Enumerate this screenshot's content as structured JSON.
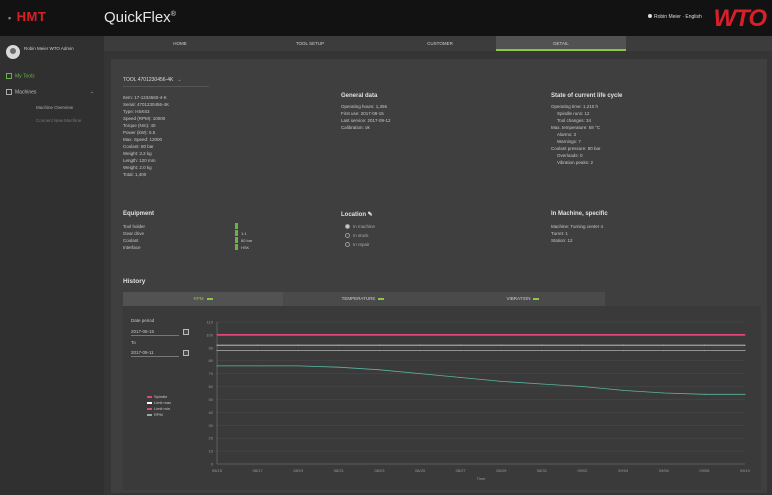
{
  "topbar": {
    "left_logo": "HMT",
    "app_title": "QuickFlex",
    "app_title_mark": "®",
    "user_menu": "Robin Meier · English",
    "brand_logo": "WTO"
  },
  "sidebar": {
    "profile_name": "Robin Meier WTO Admin",
    "items": [
      {
        "label": "My Tools",
        "icon": "wrench-icon"
      },
      {
        "label": "Machines",
        "icon": "machine-icon"
      }
    ],
    "sub_items": [
      "Machine Overview",
      "Connect New Machine"
    ]
  },
  "tabs": [
    "HOME",
    "TOOL SETUP",
    "CUSTOMER",
    "DETAIL"
  ],
  "active_tab": "DETAIL",
  "tool": {
    "header": "TOOL 4701230456-4K",
    "left_fields": [
      "Item: 17-1234560-4-K",
      "Serial: 4701230456-4K",
      "Type: HSK63",
      "Speed (RPM): 10000",
      "Torque (Nm): 40",
      "Power (kW): 5.5",
      "Max. Speed: 12000",
      "Coolant: 80 bar",
      "Weight: 3.2 kg",
      "Length: 120 mm",
      "Weight: 2.0 kg",
      "Total: 1,400"
    ],
    "general_title": "General data",
    "general_fields": [
      "Operating hours: 1,356",
      "First use: 2017-08-15",
      "Last service: 2017-09-12",
      "Calibration: ok"
    ],
    "state_title": "State of current life cycle",
    "state_fields": [
      "Operating time: 1,210 h",
      "Spindle runs: 12",
      "Tool changes: 34",
      "Max. temperature: 58 °C",
      "Alarms: 3",
      "Warnings: 7",
      "Coolant pressure: 80 bar",
      "Overloads: 0",
      "Vibration peaks: 2"
    ]
  },
  "equipment": {
    "title": "Equipment",
    "rows": [
      {
        "label": "Tool holder",
        "value": ""
      },
      {
        "label": "Gear drive",
        "value": "1:1"
      },
      {
        "label": "Coolant",
        "value": "80 bar"
      },
      {
        "label": "Interface",
        "value": "HSK"
      }
    ]
  },
  "location": {
    "title": "Location",
    "options": [
      "In machine",
      "In stock",
      "In repair"
    ],
    "selected": 0
  },
  "machine_specific": {
    "title": "In Machine, specific",
    "fields": [
      "Machine: Turning center 4",
      "Turret: 1",
      "Station: 12"
    ]
  },
  "history": {
    "title": "History",
    "subtabs": [
      "RPM",
      "TEMPERATURE",
      "VIBRATION"
    ],
    "active_subtab": 0,
    "date_label": "Date period",
    "from_date": "2017-08-15",
    "to_label": "To",
    "to_date": "2017-09-11",
    "legend": [
      {
        "name": "Spindle",
        "color": "#e0457b"
      },
      {
        "name": "Limit max",
        "color": "#ffffff"
      },
      {
        "name": "Limit min",
        "color": "#e0457b"
      },
      {
        "name": "RPM",
        "color": "#9aa3a8"
      }
    ],
    "x_axis_label": "Time"
  },
  "chart_data": {
    "type": "line",
    "x_ticks": [
      "08/15",
      "08/17",
      "08/19",
      "08/21",
      "08/23",
      "08/25",
      "08/27",
      "08/29",
      "08/31",
      "09/02",
      "09/04",
      "09/06",
      "09/08",
      "09/10"
    ],
    "series": [
      {
        "name": "Spindle",
        "color": "#e0457b",
        "values": [
          100,
          100,
          100,
          100,
          100,
          100,
          100,
          100,
          100,
          100,
          100,
          100,
          100,
          100
        ]
      },
      {
        "name": "Limit max",
        "color": "#d0d0d0",
        "values": [
          92,
          92,
          92,
          92,
          92,
          92,
          92,
          92,
          92,
          92,
          92,
          92,
          92,
          92
        ]
      },
      {
        "name": "Limit min",
        "color": "#b0b0b0",
        "values": [
          88,
          88,
          88,
          88,
          88,
          88,
          88,
          88,
          88,
          88,
          88,
          88,
          88,
          88
        ]
      },
      {
        "name": "RPM",
        "color": "#5bb5a2",
        "values": [
          76,
          76,
          76,
          75,
          73,
          70,
          67,
          64,
          62,
          60,
          57,
          55,
          54,
          54
        ]
      }
    ],
    "ylim": [
      0,
      110
    ],
    "grid": true,
    "legend_position": "left"
  }
}
